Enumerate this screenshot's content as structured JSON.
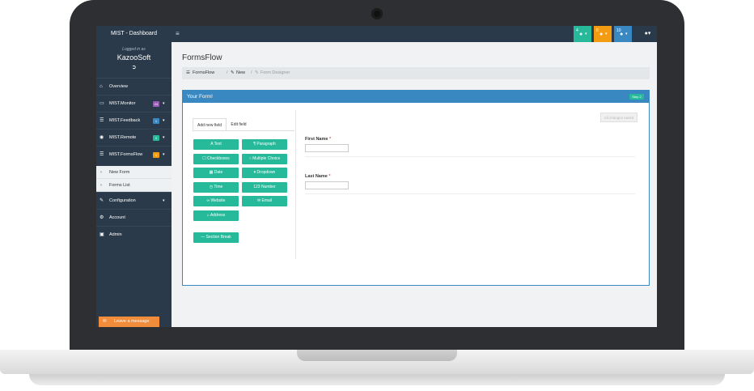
{
  "topbar": {
    "brand": "MIST - Dashboard",
    "menu_icon": "hamburger-icon",
    "notifications": [
      {
        "count": "4",
        "color": "#26b99a"
      },
      {
        "count": "6",
        "color": "#f39c12"
      },
      {
        "count": "10",
        "color": "#3a88c2"
      }
    ],
    "user_icon": "user-icon"
  },
  "sidebar": {
    "logged_in_label": "Logged in as",
    "company": "KazooSoft",
    "items": [
      {
        "label": "Overview",
        "icon": "home-icon"
      },
      {
        "label": "MIST.Monitor",
        "icon": "monitor-icon",
        "badge": "24",
        "badge_color": "#9b59b6"
      },
      {
        "label": "MIST.Feedback",
        "icon": "list-icon",
        "badge": "1",
        "badge_color": "#3a88c2"
      },
      {
        "label": "MIST.Remote",
        "icon": "users-icon",
        "badge": "0",
        "badge_color": "#26b99a"
      },
      {
        "label": "MIST.FormsFlow",
        "icon": "list-icon",
        "badge": "1",
        "badge_color": "#f39c12"
      }
    ],
    "subitems": [
      {
        "label": "New Form"
      },
      {
        "label": "Forms List"
      }
    ],
    "lower_items": [
      {
        "label": "Configuration",
        "icon": "edit-icon"
      },
      {
        "label": "Account",
        "icon": "gear-icon"
      },
      {
        "label": "Admin",
        "icon": "lock-icon"
      }
    ],
    "leave_message": "Leave a message"
  },
  "page": {
    "title": "FormsFlow",
    "breadcrumb": [
      "FormsFlow",
      "New",
      "Form Designer"
    ]
  },
  "panel": {
    "title": "Your Form!",
    "step": "Step 2",
    "tabs": [
      "Add new field",
      "Edit field"
    ],
    "field_buttons": [
      "Text",
      "Paragraph",
      "Checkboxes",
      "Multiple Choice",
      "Date",
      "Dropdown",
      "Time",
      "Number",
      "Website",
      "Email",
      "Address"
    ],
    "section_break": "Section Break",
    "saved_label": "All changes saved",
    "fields": [
      {
        "label": "First Name",
        "required": "*"
      },
      {
        "label": "Last Name",
        "required": "*"
      }
    ]
  }
}
